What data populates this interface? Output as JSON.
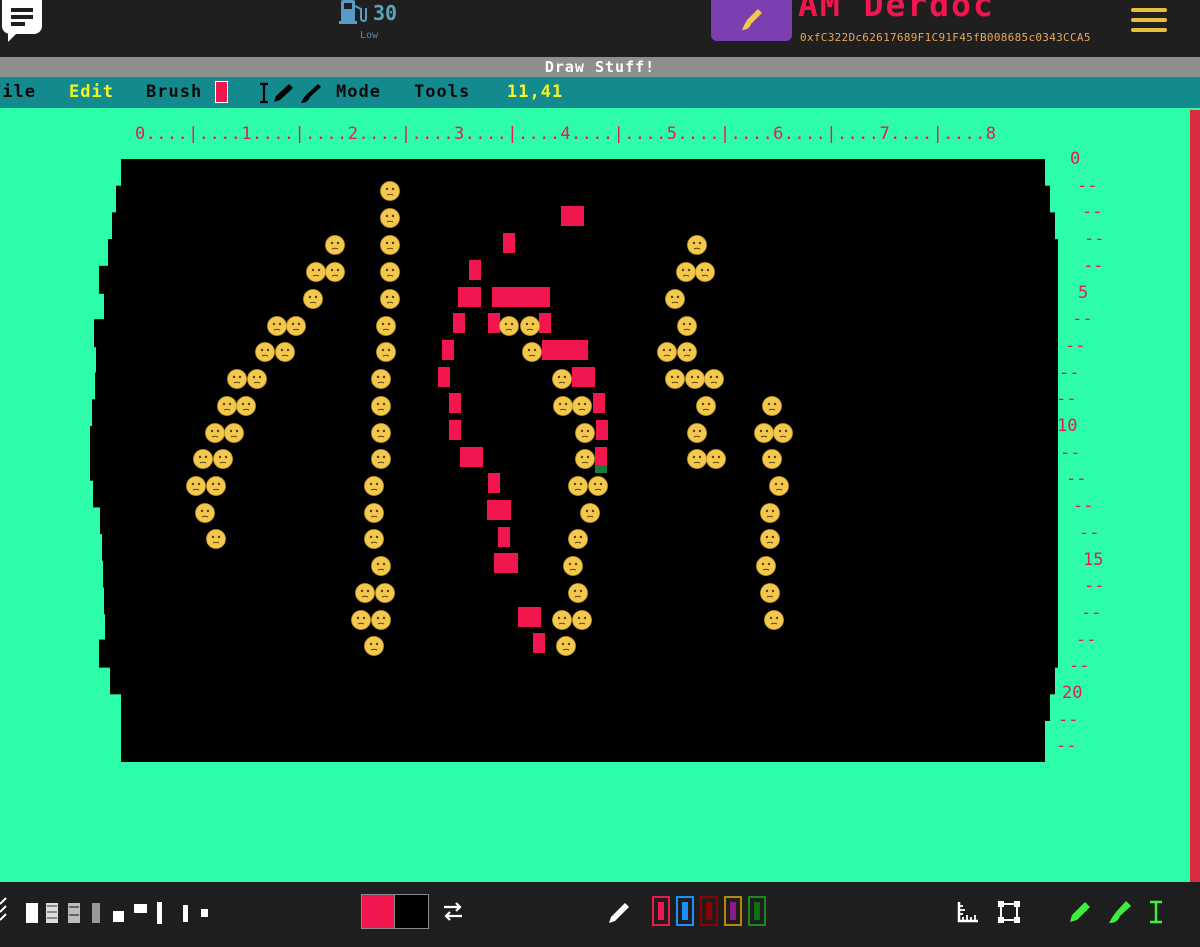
{
  "header": {
    "gas_value": "30",
    "gas_label": "Low",
    "username": "AM Derdoc",
    "address": "0xfC322Dc62617689F1C91F45fB008685c0343CCA5",
    "icons": [
      "chat-icon",
      "gas-pump-icon",
      "paintbrush-icon",
      "hamburger-menu-icon"
    ]
  },
  "window": {
    "title": "Draw Stuff!"
  },
  "menu": {
    "file": "File",
    "edit": "Edit",
    "brush": "Brush",
    "mode": "Mode",
    "tools": "Tools",
    "cursor_coords": "11,41"
  },
  "ruler": {
    "top": "0....|....1....|....2....|....3....|....4....|....5....|....6....|....7....|....8",
    "left_numbers": [
      "0",
      "5",
      "10",
      "15",
      "20"
    ],
    "tick_mark": "--"
  },
  "palette": {
    "foreground": "#f2164f",
    "background": "#000000",
    "swatches": [
      {
        "border": "#f2164f",
        "fill": "#f2164f"
      },
      {
        "border": "#1e8fff",
        "fill": "#1e8fff"
      },
      {
        "border": "#8b0000",
        "fill": "#8b0000"
      },
      {
        "border": "#b8860b",
        "fill": "#8b1a8b"
      },
      {
        "border": "#1a8a1a",
        "fill": "#0f6e0f"
      }
    ]
  },
  "colors": {
    "background": "#2dfda8",
    "accent_red": "#f2164f",
    "menubar": "#138b8e",
    "title": "#8e8e8e",
    "coords": "#f5f521",
    "emoji": "#f2c94c"
  },
  "bottom_tools": [
    "brush-size-icons",
    "swap-colors-icon",
    "eyedropper-icon",
    "ruler-icon",
    "select-frame-icon",
    "pencil-icon",
    "brush-icon",
    "text-cursor-icon"
  ]
}
